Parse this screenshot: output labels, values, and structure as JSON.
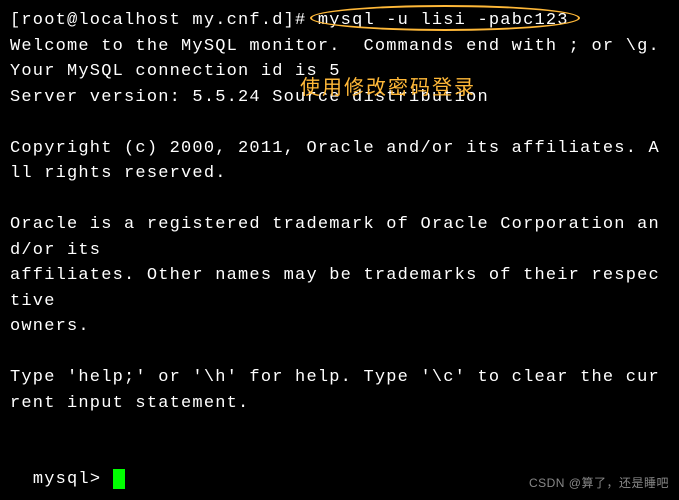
{
  "prompt": "[root@localhost my.cnf.d]# ",
  "command": "mysql -u lisi -pabc123",
  "output": {
    "line1": "Welcome to the MySQL monitor.  Commands end with ; or \\g.",
    "line2": "Your MySQL connection id is 5",
    "line3": "Server version: 5.5.24 Source distribution",
    "line4": "Copyright (c) 2000, 2011, Oracle and/or its affiliates. All rights reserved.",
    "line5": "Oracle is a registered trademark of Oracle Corporation and/or its",
    "line6": "affiliates. Other names may be trademarks of their respective",
    "line7": "owners.",
    "line8": "Type 'help;' or '\\h' for help. Type '\\c' to clear the current input statement."
  },
  "mysql_prompt": "mysql> ",
  "annotation": "使用修改密码登录",
  "watermark": "CSDN @算了，还是睡吧"
}
